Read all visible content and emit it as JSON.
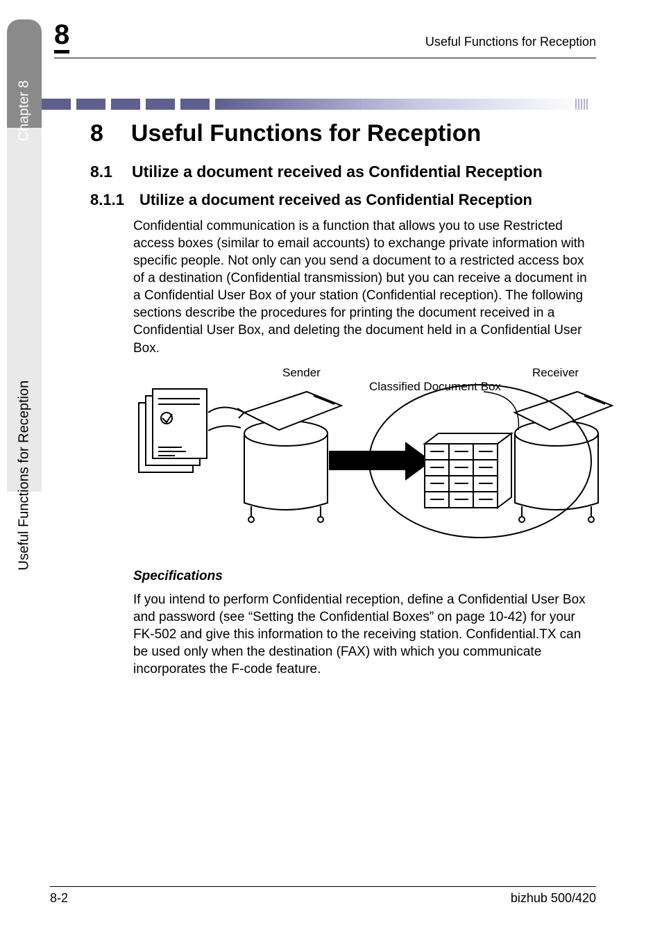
{
  "header": {
    "chapter_badge": "8",
    "running_title": "Useful Functions for Reception"
  },
  "side_tab": {
    "chapter_label": "Chapter 8",
    "section_label": "Useful Functions for Reception"
  },
  "chapter_title": {
    "number": "8",
    "text": "Useful Functions for Reception"
  },
  "section": {
    "number": "8.1",
    "title": "Utilize a document received as Confidential Reception"
  },
  "subsection": {
    "number": "8.1.1",
    "title": "Utilize a document received as Confidential Reception"
  },
  "body_paragraph_1": "Confidential communication is a function that allows you to use Restricted access boxes (similar to email accounts) to exchange private information with specific people. Not only can you send a document to a restricted access box of a destination (Confidential transmission) but you can receive a document in a Confidential User Box of your station (Confidential reception). The following sections describe the procedures for printing the document received in a Confidential User Box, and deleting the document held in a Confidential User Box.",
  "diagram": {
    "sender_label": "Sender",
    "receiver_label": "Receiver",
    "box_label": "Classified Document Box"
  },
  "spec_heading": "Specifications",
  "spec_paragraph": "If you intend to perform Confidential reception, define a Confidential User Box and password (see “Setting the Confidential Boxes” on page 10-42) for your FK-502 and give this information to the receiving station. Confidential.TX can be used only when the destination (FAX) with which you communicate incorporates the F-code feature.",
  "footer": {
    "page": "8-2",
    "model": "bizhub 500/420"
  }
}
